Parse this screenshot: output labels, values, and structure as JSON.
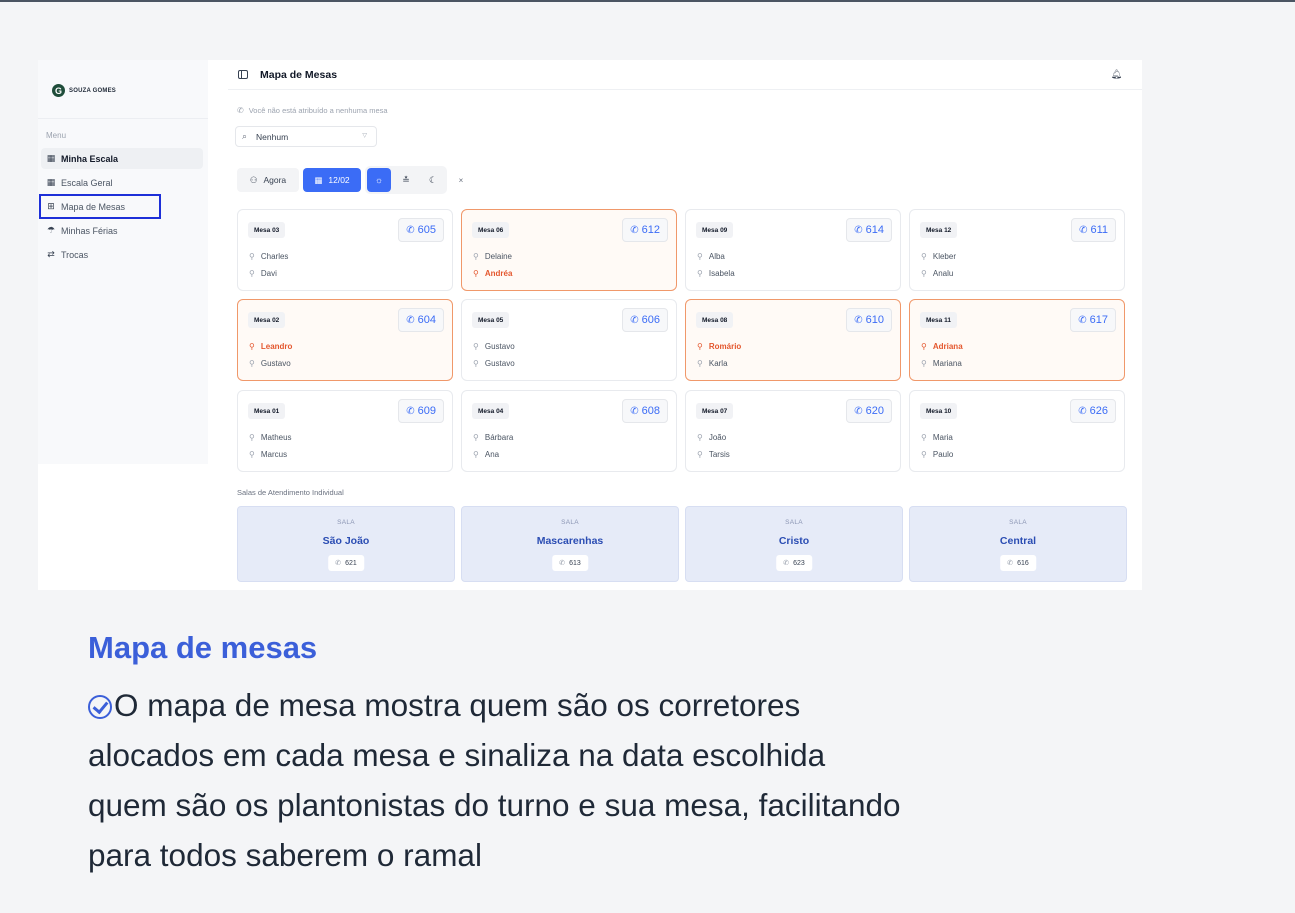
{
  "sidebar": {
    "logo_text": "SOUZA GOMES",
    "menu_label": "Menu",
    "items": [
      {
        "label": "Minha Escala",
        "icon": "calendar-icon"
      },
      {
        "label": "Escala Geral",
        "icon": "calendar-icon"
      },
      {
        "label": "Mapa de Mesas",
        "icon": "grid-icon"
      },
      {
        "label": "Minhas Férias",
        "icon": "umbrella-icon"
      },
      {
        "label": "Trocas",
        "icon": "shuffle-icon"
      }
    ]
  },
  "header": {
    "title": "Mapa de Mesas"
  },
  "notice": "Você não está atribuído a nenhuma mesa",
  "select": {
    "value": "Nenhum"
  },
  "toolbar": {
    "now_label": "Agora",
    "date_label": "12/02",
    "close_label": "×"
  },
  "cards": [
    {
      "mesa": "Mesa 03",
      "ext": "605",
      "people": [
        {
          "name": "Charles",
          "duty": false
        },
        {
          "name": "Davi",
          "duty": false
        }
      ],
      "highlight": false
    },
    {
      "mesa": "Mesa 06",
      "ext": "612",
      "people": [
        {
          "name": "Delaine",
          "duty": false
        },
        {
          "name": "Andréa",
          "duty": true
        }
      ],
      "highlight": true
    },
    {
      "mesa": "Mesa 09",
      "ext": "614",
      "people": [
        {
          "name": "Alba",
          "duty": false
        },
        {
          "name": "Isabela",
          "duty": false
        }
      ],
      "highlight": false
    },
    {
      "mesa": "Mesa 12",
      "ext": "611",
      "people": [
        {
          "name": "Kleber",
          "duty": false
        },
        {
          "name": "Analu",
          "duty": false
        }
      ],
      "highlight": false
    },
    {
      "mesa": "Mesa 02",
      "ext": "604",
      "people": [
        {
          "name": "Leandro",
          "duty": true
        },
        {
          "name": "Gustavo",
          "duty": false
        }
      ],
      "highlight": true
    },
    {
      "mesa": "Mesa 05",
      "ext": "606",
      "people": [
        {
          "name": "Gustavo",
          "duty": false
        },
        {
          "name": "Gustavo",
          "duty": false
        }
      ],
      "highlight": false
    },
    {
      "mesa": "Mesa 08",
      "ext": "610",
      "people": [
        {
          "name": "Romário",
          "duty": true
        },
        {
          "name": "Karla",
          "duty": false
        }
      ],
      "highlight": true
    },
    {
      "mesa": "Mesa 11",
      "ext": "617",
      "people": [
        {
          "name": "Adriana",
          "duty": true
        },
        {
          "name": "Mariana",
          "duty": false
        }
      ],
      "highlight": true
    },
    {
      "mesa": "Mesa 01",
      "ext": "609",
      "people": [
        {
          "name": "Matheus",
          "duty": false
        },
        {
          "name": "Marcus",
          "duty": false
        }
      ],
      "highlight": false
    },
    {
      "mesa": "Mesa 04",
      "ext": "608",
      "people": [
        {
          "name": "Bárbara",
          "duty": false
        },
        {
          "name": "Ana",
          "duty": false
        }
      ],
      "highlight": false
    },
    {
      "mesa": "Mesa 07",
      "ext": "620",
      "people": [
        {
          "name": "João",
          "duty": false
        },
        {
          "name": "Tarsis",
          "duty": false
        }
      ],
      "highlight": false
    },
    {
      "mesa": "Mesa 10",
      "ext": "626",
      "people": [
        {
          "name": "Maria",
          "duty": false
        },
        {
          "name": "Paulo",
          "duty": false
        }
      ],
      "highlight": false
    }
  ],
  "rooms_label": "Salas de Atendimento Individual",
  "rooms": [
    {
      "kicker": "SALA",
      "name": "São João",
      "ext": "621"
    },
    {
      "kicker": "SALA",
      "name": "Mascarenhas",
      "ext": "613"
    },
    {
      "kicker": "SALA",
      "name": "Cristo",
      "ext": "623"
    },
    {
      "kicker": "SALA",
      "name": "Central",
      "ext": "616"
    }
  ],
  "caption": {
    "title": "Mapa de mesas",
    "lines": [
      "O mapa de mesa mostra quem são os corretores",
      "alocados em cada mesa e sinaliza na data escolhida",
      "quem são os plantonistas do turno e sua mesa, facilitando",
      "para todos saberem o ramal"
    ]
  },
  "colors": {
    "accent": "#3b6cf6",
    "duty": "#e4572e",
    "highlight_border": "#f0986a",
    "caption_title": "#3b5fd9"
  }
}
